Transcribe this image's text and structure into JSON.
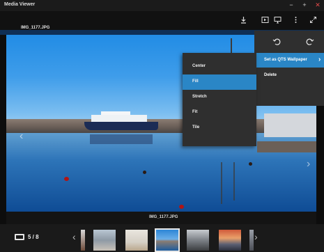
{
  "window": {
    "title": "Media Viewer"
  },
  "toolbar": {
    "filename": "IMG_1177.JPG"
  },
  "menu": {
    "set_wallpaper_label": "Set as QTS Wallpaper",
    "delete_label": "Delete",
    "highlight_color": "#2a86c6"
  },
  "submenu": {
    "options": [
      {
        "label": "Center"
      },
      {
        "label": "Fill"
      },
      {
        "label": "Stretch"
      },
      {
        "label": "Fit"
      },
      {
        "label": "Tile"
      }
    ],
    "selected": "Fill"
  },
  "caption": "IMG_1177.JPG",
  "filmstrip": {
    "counter": "5 / 8"
  },
  "icons": {
    "minimize": "−",
    "maximize": "+",
    "close": "✕",
    "prev": "‹",
    "next": "›",
    "chevron": "›"
  }
}
